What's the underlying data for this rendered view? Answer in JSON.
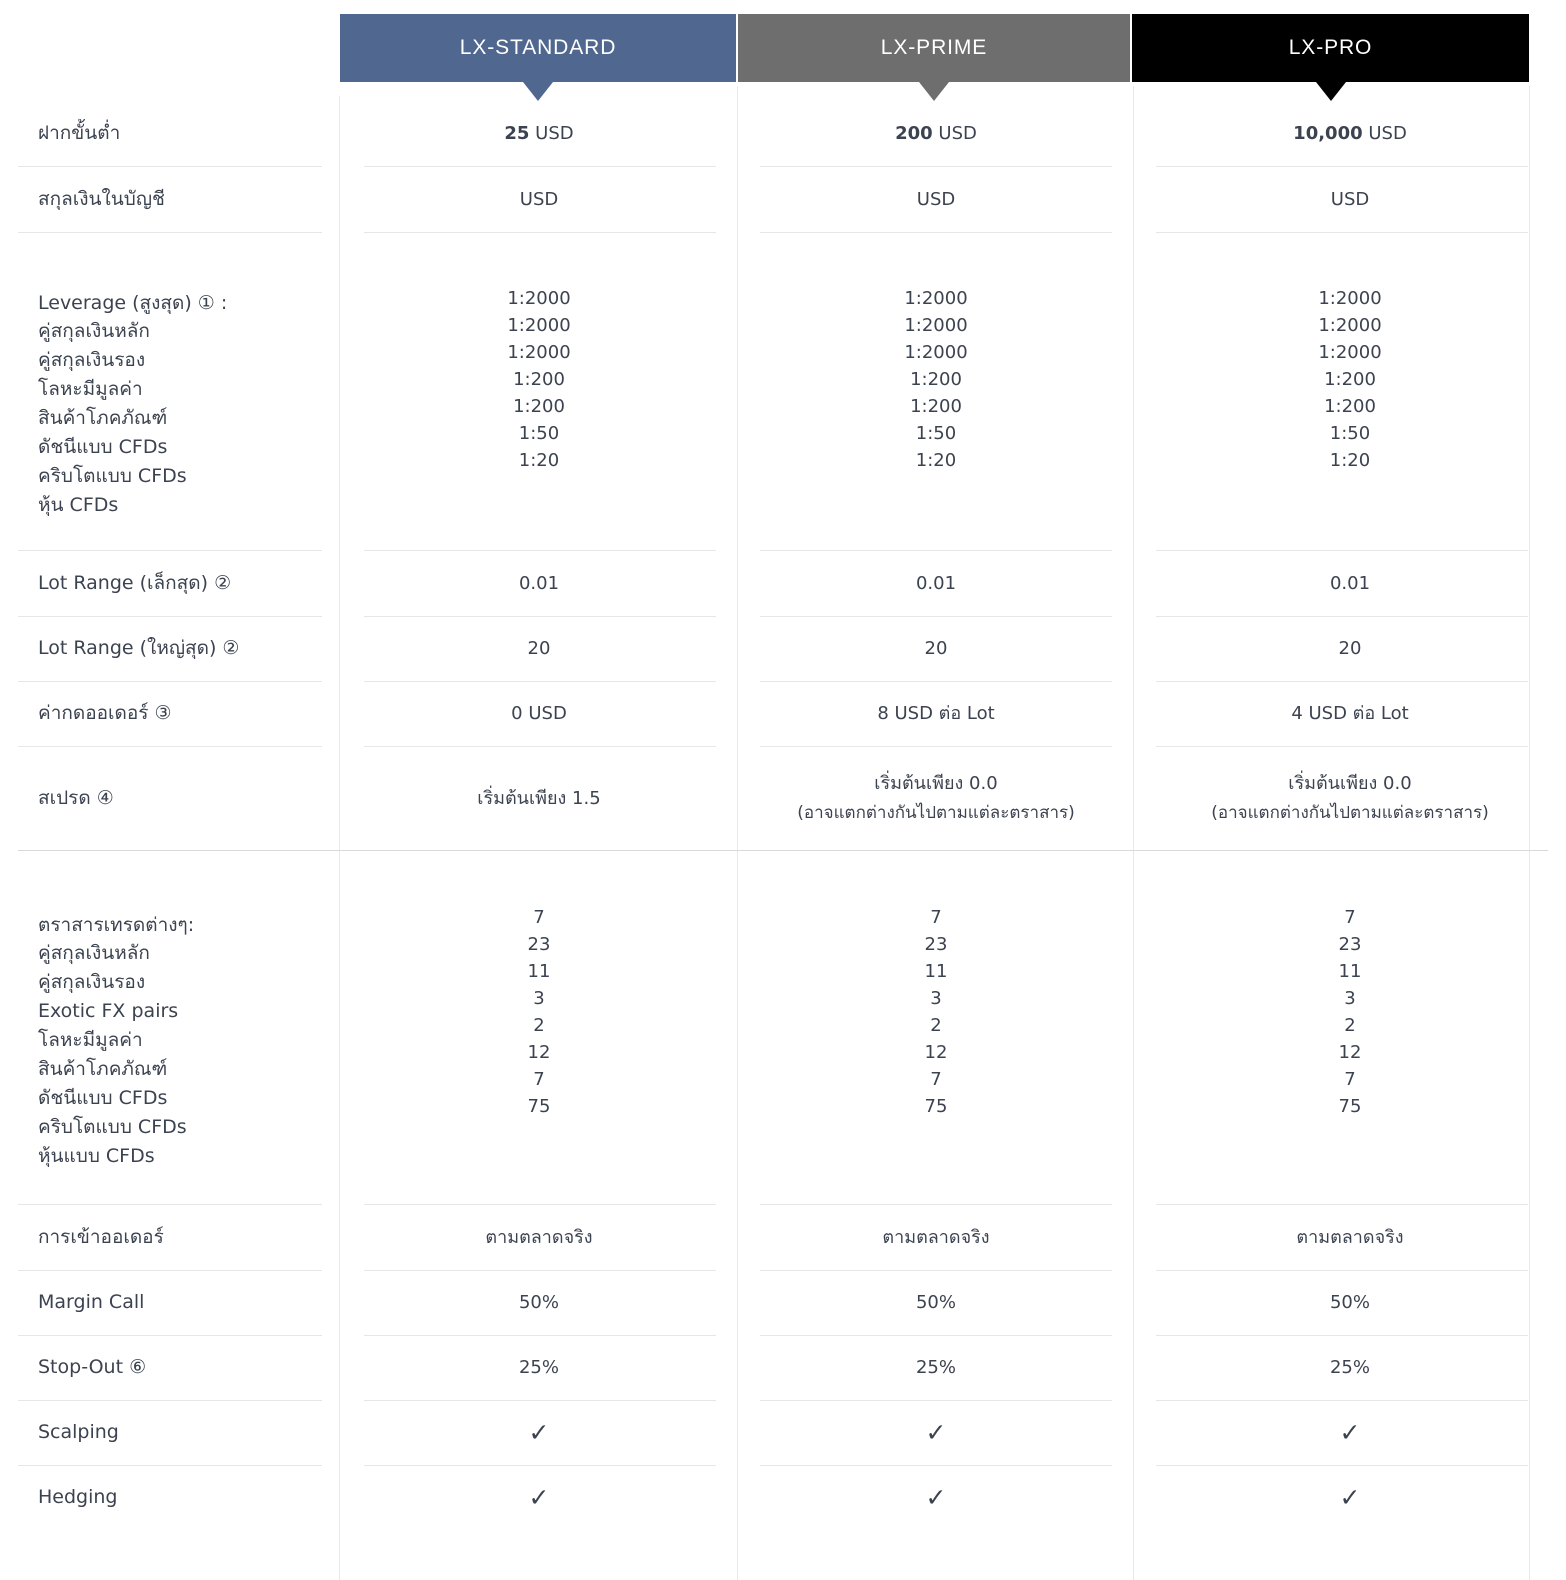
{
  "plans": [
    {
      "name": "LX-STANDARD",
      "color": "#50688f"
    },
    {
      "name": "LX-PRIME",
      "color": "#6e6e6e"
    },
    {
      "name": "LX-PRO",
      "color": "#000000"
    }
  ],
  "rows": {
    "min_deposit": {
      "label": "ฝากขั้นต่ำ",
      "values": [
        {
          "amount": "25",
          "unit": " USD"
        },
        {
          "amount": "200",
          "unit": " USD"
        },
        {
          "amount": "10,000",
          "unit": " USD"
        }
      ]
    },
    "account_currency": {
      "label": "สกุลเงินในบัญชี",
      "values": [
        "USD",
        "USD",
        "USD"
      ]
    },
    "leverage": {
      "heading": "Leverage (สูงสุด) ① :",
      "items": [
        {
          "label": "คู่สกุลเงินหลัก",
          "values": [
            "1:2000",
            "1:2000",
            "1:2000"
          ]
        },
        {
          "label": "คู่สกุลเงินรอง",
          "values": [
            "1:2000",
            "1:2000",
            "1:2000"
          ]
        },
        {
          "label": "โลหะมีมูลค่า",
          "values": [
            "1:2000",
            "1:2000",
            "1:2000"
          ]
        },
        {
          "label": "สินค้าโภคภัณฑ์",
          "values": [
            "1:200",
            "1:200",
            "1:200"
          ]
        },
        {
          "label": "ดัชนีแบบ CFDs",
          "values": [
            "1:200",
            "1:200",
            "1:200"
          ]
        },
        {
          "label": "คริบโตแบบ CFDs",
          "values": [
            "1:50",
            "1:50",
            "1:50"
          ]
        },
        {
          "label": "หุ้น  CFDs",
          "values": [
            "1:20",
            "1:20",
            "1:20"
          ]
        }
      ]
    },
    "lot_min": {
      "label": "Lot Range (เล็กสุด) ②",
      "values": [
        "0.01",
        "0.01",
        "0.01"
      ]
    },
    "lot_max": {
      "label": "Lot Range (ใหญ่สุด) ②",
      "values": [
        "20",
        "20",
        "20"
      ]
    },
    "commission": {
      "label": "ค่ากดออเดอร์ ③",
      "values": [
        "0 USD",
        "8 USD ต่อ Lot",
        "4 USD ต่อ Lot"
      ]
    },
    "spread": {
      "label": "สเปรด ④",
      "values": [
        {
          "main": "เริ่มต้นเพียง 1.5",
          "note": ""
        },
        {
          "main": "เริ่มต้นเพียง 0.0",
          "note": "(อาจแตกต่างกันไปตามแต่ละตราสาร)"
        },
        {
          "main": "เริ่มต้นเพียง 0.0",
          "note": "(อาจแตกต่างกันไปตามแต่ละตราสาร)"
        }
      ]
    },
    "instruments": {
      "heading": "ตราสารเทรดต่างๆ:",
      "items": [
        {
          "label": "คู่สกุลเงินหลัก",
          "values": [
            "7",
            "7",
            "7"
          ]
        },
        {
          "label": "คู่สกุลเงินรอง",
          "values": [
            "23",
            "23",
            "23"
          ]
        },
        {
          "label": "Exotic FX pairs",
          "values": [
            "11",
            "11",
            "11"
          ]
        },
        {
          "label": "โลหะมีมูลค่า",
          "values": [
            "3",
            "3",
            "3"
          ]
        },
        {
          "label": "สินค้าโภคภัณฑ์",
          "values": [
            "2",
            "2",
            "2"
          ]
        },
        {
          "label": "ดัชนีแบบ CFDs",
          "values": [
            "12",
            "12",
            "12"
          ]
        },
        {
          "label": "คริบโตแบบ CFDs",
          "values": [
            "7",
            "7",
            "7"
          ]
        },
        {
          "label": "หุ้นแบบ CFDs",
          "values": [
            "75",
            "75",
            "75"
          ]
        }
      ]
    },
    "execution": {
      "label": "การเข้าออเดอร์",
      "values": [
        "ตามตลาดจริง",
        "ตามตลาดจริง",
        "ตามตลาดจริง"
      ]
    },
    "margin_call": {
      "label": "Margin Call",
      "values": [
        "50%",
        "50%",
        "50%"
      ]
    },
    "stop_out": {
      "label": "Stop-Out ⑥",
      "values": [
        "25%",
        "25%",
        "25%"
      ]
    },
    "scalping": {
      "label": "Scalping",
      "values": [
        "✓",
        "✓",
        "✓"
      ]
    },
    "hedging": {
      "label": "Hedging",
      "values": [
        "✓",
        "✓",
        "✓"
      ]
    }
  }
}
